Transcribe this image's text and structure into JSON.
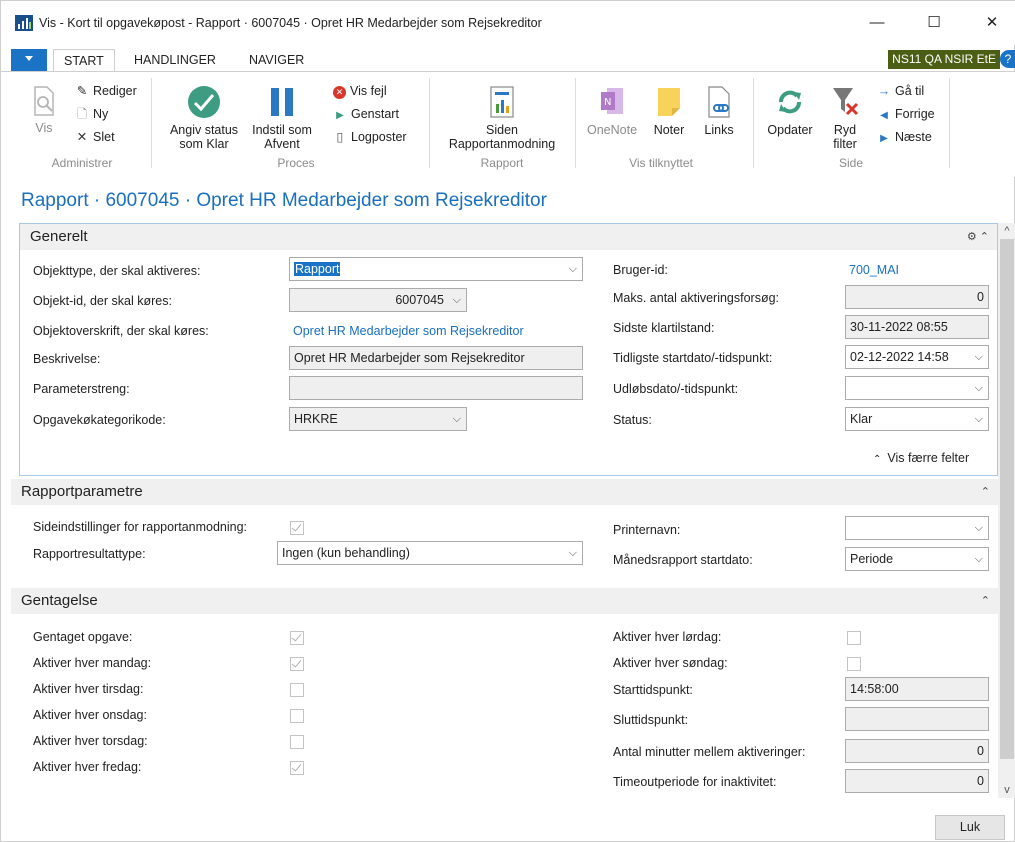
{
  "window": {
    "title": "Vis - Kort til opgavekøpost - Rapport · 6007045 · Opret HR Medarbejder som Rejsekreditor",
    "minimize": "—",
    "maximize": "☐",
    "close": "✕"
  },
  "tabs": {
    "start": "START",
    "handlinger": "HANDLINGER",
    "naviger": "NAVIGER",
    "company": "NS11 QA NSIR EtE",
    "help": "?"
  },
  "ribbon": {
    "vis": "Vis",
    "rediger": "Rediger",
    "ny": "Ny",
    "slet": "Slet",
    "group_administrer": "Administrer",
    "angiv_status": "Angiv status som Klar",
    "indstil_som": "Indstil som Afvent",
    "vis_fejl": "Vis fejl",
    "genstart": "Genstart",
    "logposter": "Logposter",
    "group_proces": "Proces",
    "siden": "Siden Rapportanmodning",
    "group_rapport": "Rapport",
    "onenote": "OneNote",
    "noter": "Noter",
    "links": "Links",
    "group_vis_tilknyttet": "Vis tilknyttet",
    "opdater": "Opdater",
    "ryd_filter": "Ryd filter",
    "ga_til": "Gå til",
    "forrige": "Forrige",
    "naeste": "Næste",
    "group_side": "Side"
  },
  "page_title": "Rapport · 6007045 · Opret HR Medarbejder som Rejsekreditor",
  "general": {
    "header": "Generelt",
    "objekttype_label": "Objekttype, der skal aktiveres:",
    "objekttype_value": "Rapport",
    "objekt_id_label": "Objekt-id, der skal køres:",
    "objekt_id_value": "6007045",
    "objektoverskrift_label": "Objektoverskrift, der skal køres:",
    "objektoverskrift_value": "Opret HR Medarbejder som Rejsekreditor",
    "beskrivelse_label": "Beskrivelse:",
    "beskrivelse_value": "Opret HR Medarbejder som Rejsekreditor",
    "parameterstreng_label": "Parameterstreng:",
    "parameterstreng_value": "",
    "kategori_label": "Opgavekøkategorikode:",
    "kategori_value": "HRKRE",
    "bruger_label": "Bruger-id:",
    "bruger_value": "700_MAI",
    "maks_label": "Maks. antal aktiveringsforsøg:",
    "maks_value": "0",
    "klar_label": "Sidste klartilstand:",
    "klar_value": "30-11-2022 08:55",
    "start_label": "Tidligste startdato/-tidspunkt:",
    "start_value": "02-12-2022 14:58",
    "udloeb_label": "Udløbsdato/-tidspunkt:",
    "udloeb_value": "",
    "status_label": "Status:",
    "status_value": "Klar",
    "fewer_fields": "Vis færre felter"
  },
  "rapport": {
    "header": "Rapportparametre",
    "sideindst_label": "Sideindstillinger for rapportanmodning:",
    "resultattype_label": "Rapportresultattype:",
    "resultattype_value": "Ingen (kun behandling)",
    "printer_label": "Printernavn:",
    "printer_value": "",
    "maaned_label": "Månedsrapport startdato:",
    "maaned_value": "Periode"
  },
  "gentagelse": {
    "header": "Gentagelse",
    "gentaget_label": "Gentaget opgave:",
    "mandag_label": "Aktiver hver mandag:",
    "tirsdag_label": "Aktiver hver tirsdag:",
    "onsdag_label": "Aktiver hver onsdag:",
    "torsdag_label": "Aktiver hver torsdag:",
    "fredag_label": "Aktiver hver fredag:",
    "loerdag_label": "Aktiver hver lørdag:",
    "soendag_label": "Aktiver hver søndag:",
    "starttid_label": "Starttidspunkt:",
    "starttid_value": "14:58:00",
    "sluttid_label": "Sluttidspunkt:",
    "sluttid_value": "",
    "minutter_label": "Antal minutter mellem aktiveringer:",
    "minutter_value": "0",
    "timeout_label": "Timeoutperiode for inaktivitet:",
    "timeout_value": "0"
  },
  "footer": {
    "luk": "Luk"
  }
}
